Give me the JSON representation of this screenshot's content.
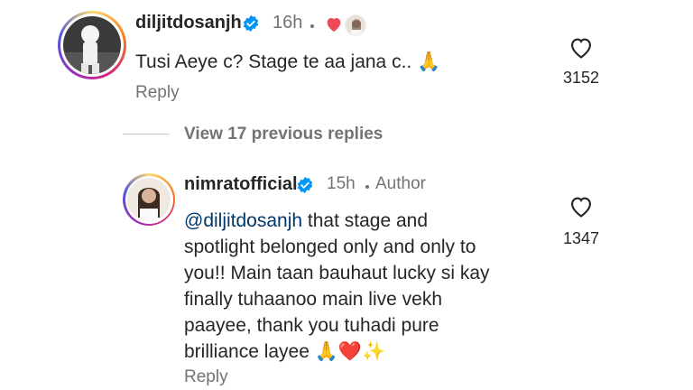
{
  "comments": [
    {
      "username": "diljitdosanjh",
      "time": "16h",
      "text": "Tusi Aeye c? Stage te aa jana c..",
      "text_emoji": "🙏",
      "reply_label": "Reply",
      "like_count": "3152"
    }
  ],
  "view_replies": "View 17 previous replies",
  "reply": {
    "username": "nimratofficial",
    "time": "15h",
    "author_badge": "Author",
    "mention": "@diljitdosanjh",
    "lines": [
      " that stage and",
      "spotlight belonged only and only to",
      "you!! Main taan bauhaut lucky si kay",
      "finally tuhaanoo main live vekh",
      "paayee, thank you tuhadi pure",
      "brilliance layee"
    ],
    "end_emojis": "🙏❤️✨",
    "reply_label": "Reply",
    "like_count": "1347"
  },
  "colors": {
    "verified": "#0095f6",
    "heart": "#ed4956",
    "mention": "#00376b",
    "secondary": "#737373"
  }
}
